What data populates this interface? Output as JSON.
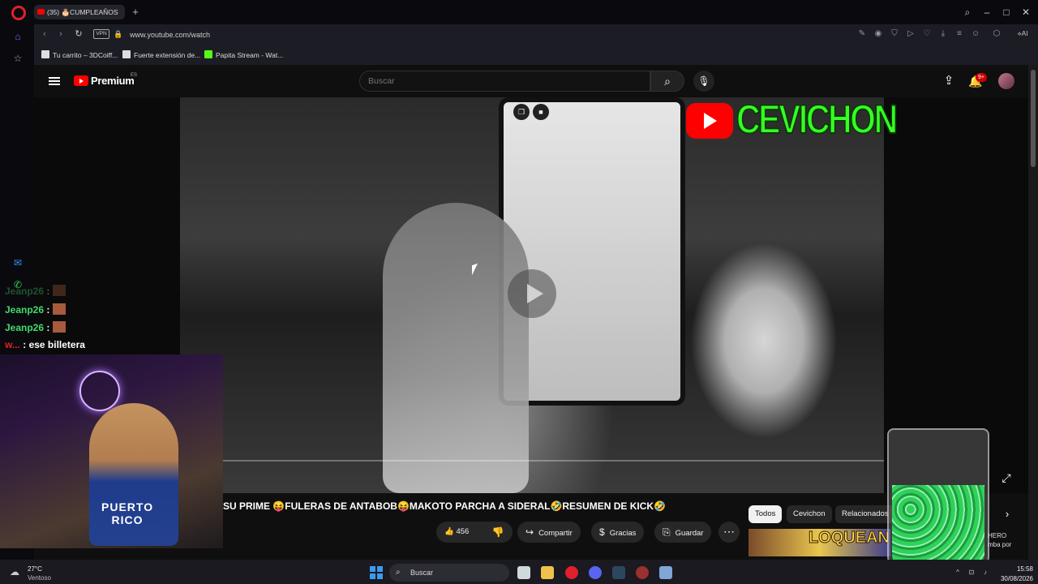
{
  "browser": {
    "tab_title": "(35) 🎂CUMPLEAÑOS",
    "url": "www.youtube.com/watch",
    "vpn_label": "VPN",
    "ai_label": "AI",
    "bookmarks": [
      "Tu carrito – 3DCoiff...",
      "Fuerte extensión de...",
      "Papita Stream - Wat..."
    ]
  },
  "youtube": {
    "logo_text": "Premium",
    "region": "ES",
    "search_placeholder": "Buscar",
    "notifications": "9+"
  },
  "video": {
    "channel_name": "CEVICHON",
    "title": "SU PRIME 😝FULERAS DE ANTABOB😝MAKOTO PARCHA A SIDERAL🤣RESUMEN DE KICK🤣",
    "likes": "456",
    "actions": {
      "share": "Compartir",
      "thanks": "Gracias",
      "save": "Guardar"
    }
  },
  "chips": [
    "Todos",
    "Cevichon",
    "Relacionados"
  ],
  "recommendation": {
    "thumb_text": "LOQUEAN",
    "side_text": "HERO\nmba por"
  },
  "stream_chat": [
    {
      "user": "Jeanp26",
      "message": ":"
    },
    {
      "user": "Jeanp26",
      "message": ":"
    },
    {
      "user": "Jeanp26",
      "message": ":"
    },
    {
      "user": "w...",
      "message": ": ese billetera"
    }
  ],
  "streamer_jersey": "PUERTO\nRICO",
  "taskbar": {
    "temperature": "27°C",
    "weather": "Ventoso",
    "search": "Buscar",
    "time": "15:58",
    "date": "30/08/2026"
  }
}
